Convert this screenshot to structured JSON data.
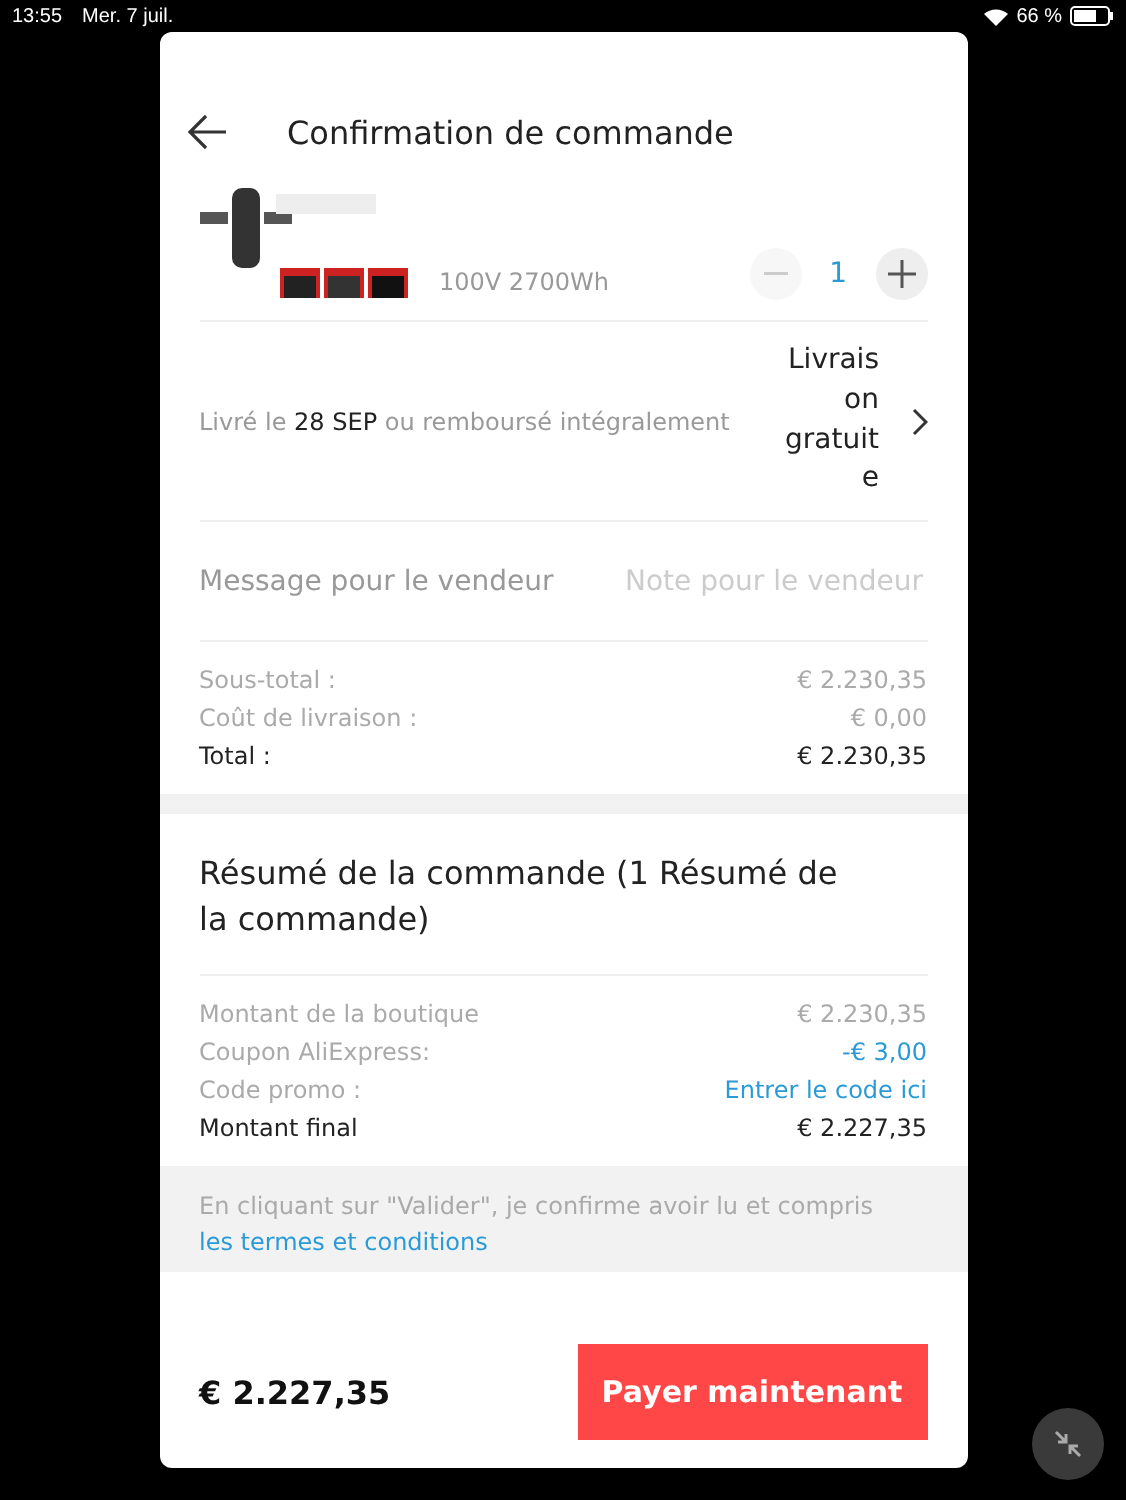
{
  "status_bar": {
    "time": "13:55",
    "date": "Mer. 7 juil.",
    "battery": "66 %"
  },
  "header": {
    "title": "Confirmation de commande"
  },
  "product": {
    "kind": "picture",
    "variant": "100V 2700Wh",
    "quantity": "1",
    "minus_disabled": true
  },
  "delivery": {
    "text": "Livré le **28 SEP** ou remboursé intégralement",
    "shipping": "Livraison gratuite"
  },
  "message": {
    "label": "Message pour le vendeur",
    "placeholder": "Note pour le vendeur"
  },
  "totals": [
    {
      "label": "Sous-total :",
      "value": "€ 2.230,35",
      "kind": "muted"
    },
    {
      "label": "Coût de livraison :",
      "value": "€ 0,00",
      "kind": "muted"
    },
    {
      "label": "Total :",
      "value": "€ 2.230,35",
      "kind": "strong"
    }
  ],
  "summary": {
    "title": "Résumé de la commande (1 Résumé de la commande)",
    "rows": [
      {
        "label": "Montant de la boutique",
        "value": "€ 2.230,35",
        "kind": "muted"
      },
      {
        "label": "Coupon AliExpress:",
        "value": "-€ 3,00",
        "kind": "accent"
      },
      {
        "label": "Code promo :",
        "value": "Entrer le code ici",
        "kind": "link"
      },
      {
        "label": "Montant final",
        "value": "€ 2.227,35",
        "kind": "strong"
      }
    ]
  },
  "terms": {
    "text": "En cliquant sur \"Valider\", je confirme avoir lu et compris ",
    "link": "les termes et conditions"
  },
  "footer": {
    "total": "€ 2.227,35",
    "button": "Payer maintenant"
  }
}
